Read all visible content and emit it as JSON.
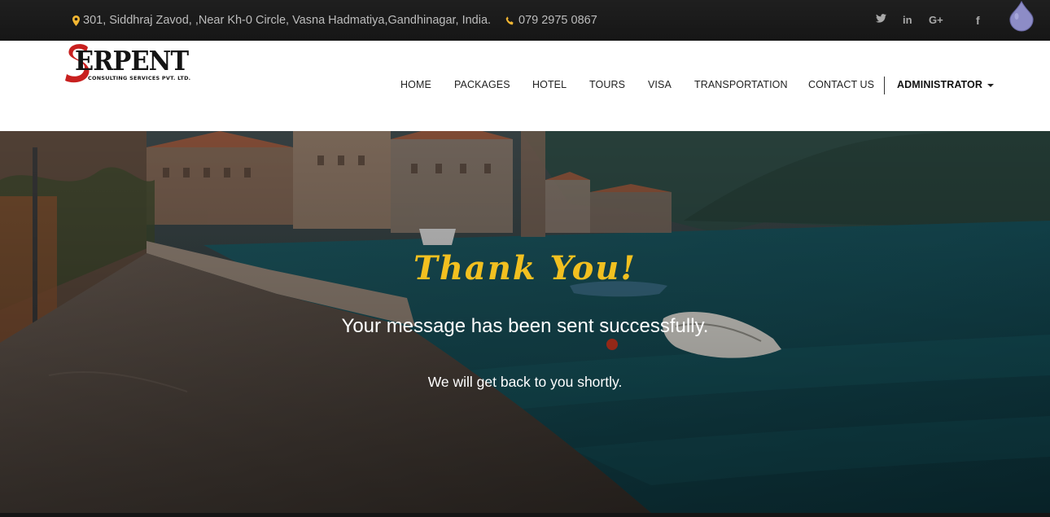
{
  "topbar": {
    "address": "301, Siddhraj Zavod, ,Near Kh-0 Circle, Vasna Hadmatiya,Gandhinagar, India.",
    "phone": "079 2975 0867",
    "social_icons": [
      "twitter-icon",
      "linkedin-icon",
      "google-plus-icon",
      "facebook-icon"
    ],
    "linkedin_glyph": "in",
    "gplus_glyph": "G+",
    "facebook_glyph": "f",
    "accent_color": "#f2b632"
  },
  "logo": {
    "word": "ERPENT",
    "subtitle": "CONSULTING SERVICES PVT. LTD."
  },
  "nav": {
    "home": "HOME",
    "packages": "PACKAGES",
    "hotel": "HOTEL",
    "tours": "TOURS",
    "visa": "VISA",
    "transportation": "TRANSPORTATION",
    "contact": "CONTACT US",
    "admin": "ADMINISTRATOR"
  },
  "hero": {
    "title": "Thank You!",
    "message": "Your message has been sent successfully.",
    "sub": "We will get back to you shortly.",
    "title_color": "#f2c020"
  }
}
